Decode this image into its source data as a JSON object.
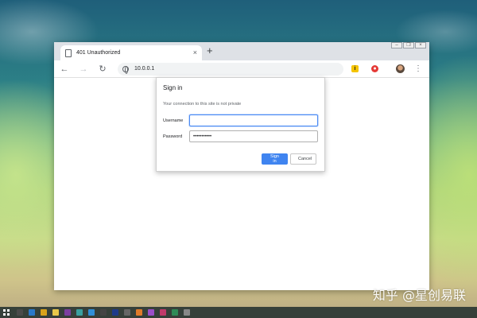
{
  "browser": {
    "tab": {
      "title": "401 Unauthorized",
      "close_glyph": "×"
    },
    "new_tab_glyph": "+",
    "window_controls": [
      "–",
      "❐",
      "×"
    ],
    "toolbar": {
      "back_glyph": "←",
      "forward_glyph": "→",
      "reload_glyph": "↻",
      "url": "10.0.0.1",
      "extension1_glyph": "i",
      "extension2_glyph": "●",
      "menu_glyph": "⋮"
    }
  },
  "dialog": {
    "title": "Sign in",
    "message": "Your connection to this site is not private",
    "username_label": "Username",
    "username_value": "",
    "password_label": "Password",
    "password_value": "•••••••••••",
    "sign_in_label": "Sign in",
    "cancel_label": "Cancel"
  },
  "taskbar": {
    "icon_colors": [
      "#4a4a4a",
      "#2b78c9",
      "#d9a21b",
      "#e8c84a",
      "#7b3fa0",
      "#3aa0a0",
      "#2f8fd8",
      "#444",
      "#1e3a8a",
      "#666",
      "#e07a2a",
      "#9c4fc9",
      "#c03a6a",
      "#2e8b57",
      "#888"
    ]
  },
  "watermark": "知乎 @星创易联"
}
